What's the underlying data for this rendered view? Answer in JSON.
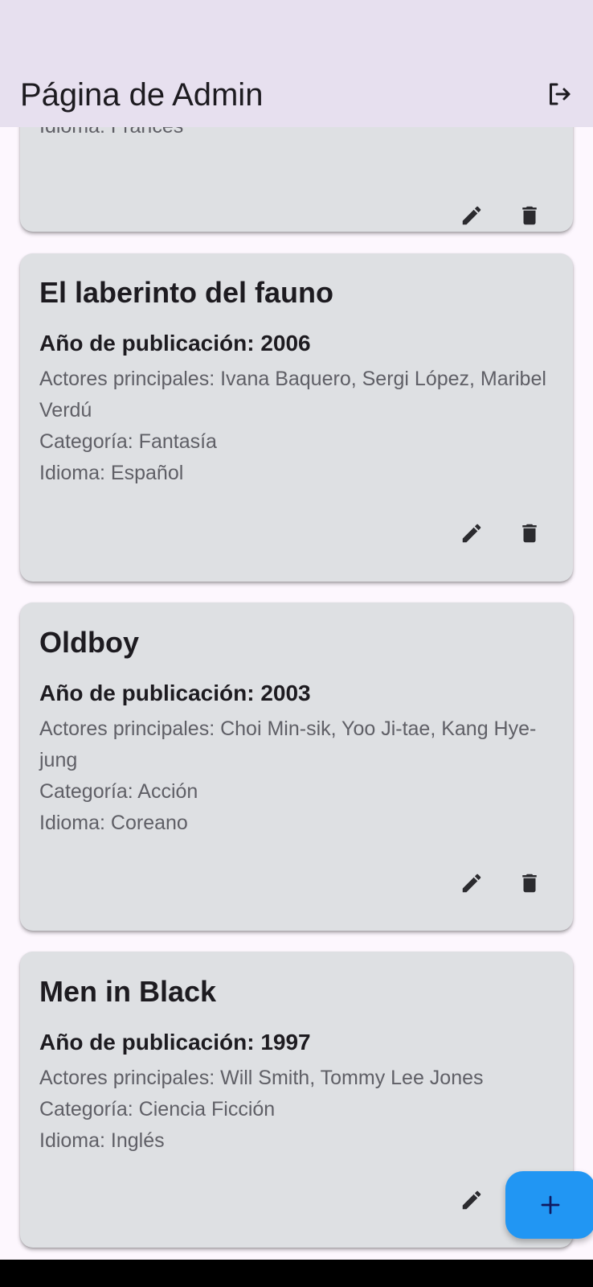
{
  "app_bar": {
    "title": "Página de Admin",
    "logout_icon": "logout-icon"
  },
  "movies": [
    {
      "partial_line": "Idioma: Francés"
    },
    {
      "title": "El laberinto del fauno",
      "year": "Año de publicación: 2006",
      "actors": "Actores principales: Ivana Baquero, Sergi López, Maribel Verdú",
      "category": "Categoría: Fantasía",
      "language": "Idioma: Español"
    },
    {
      "title": "Oldboy",
      "year": "Año de publicación: 2003",
      "actors": "Actores principales: Choi Min-sik, Yoo Ji-tae, Kang Hye-jung",
      "category": "Categoría: Acción",
      "language": "Idioma: Coreano"
    },
    {
      "title": "Men in Black",
      "year": "Año de publicación: 1997",
      "actors": "Actores principales: Will Smith, Tommy Lee Jones",
      "category": "Categoría: Ciencia Ficción",
      "language": "Idioma: Inglés"
    }
  ],
  "card_actions": {
    "edit_icon": "edit-icon",
    "delete_icon": "delete-icon"
  },
  "fab": {
    "icon": "add-icon",
    "color": "#2196f3"
  },
  "colors": {
    "app_bar": "#e7e0ef",
    "card": "#dee0e3",
    "background": "#fdf7fe"
  }
}
